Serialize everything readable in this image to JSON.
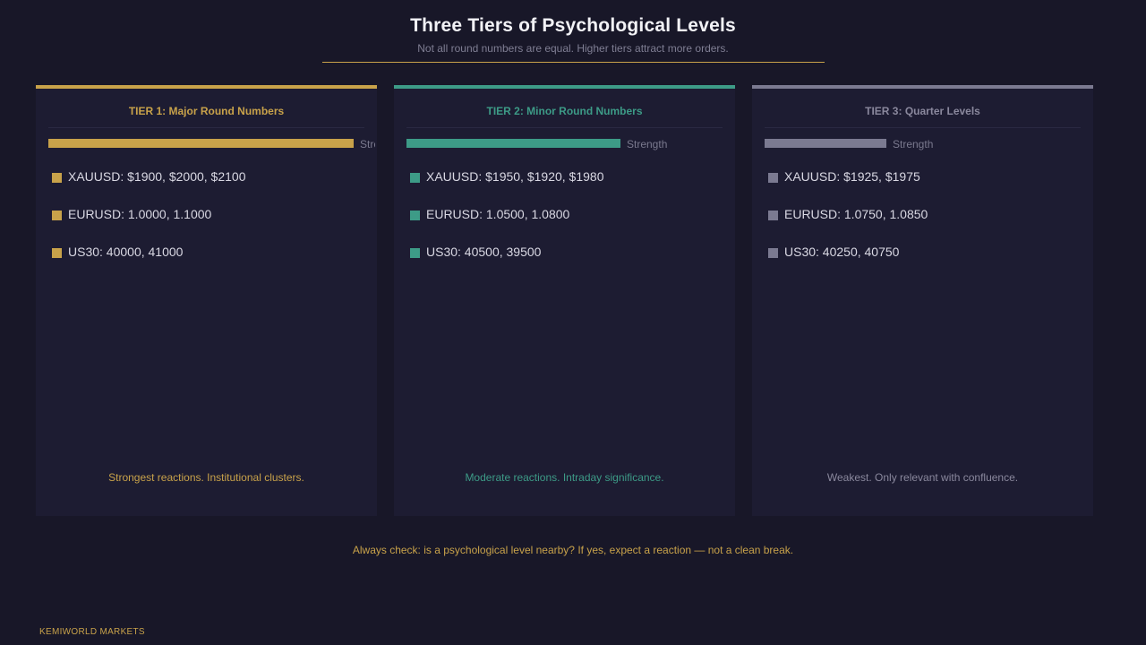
{
  "title": "Three Tiers of Psychological Levels",
  "subtitle": "Not all round numbers are equal. Higher tiers attract more orders.",
  "tiers": [
    {
      "name": "TIER 1: Major Round Numbers",
      "strength_label": "Strength",
      "strength": 1.0,
      "color": "#c8a24a",
      "levels": [
        "XAUUSD: $1900, $2000, $2100",
        "EURUSD: 1.0000, 1.1000",
        "US30: 40000, 41000"
      ],
      "footer": "Strongest reactions. Institutional clusters."
    },
    {
      "name": "TIER 2: Minor Round Numbers",
      "strength_label": "Strength",
      "strength": 0.7,
      "color": "#3d9b87",
      "levels": [
        "XAUUSD: $1950, $1920, $1980",
        "EURUSD: 1.0500, 1.0800",
        "US30: 40500, 39500"
      ],
      "footer": "Moderate reactions. Intraday significance."
    },
    {
      "name": "TIER 3: Quarter Levels",
      "strength_label": "Strength",
      "strength": 0.4,
      "color": "#7b7a91",
      "levels": [
        "XAUUSD: $1925, $1975",
        "EURUSD: 1.0750, 1.0850",
        "US30: 40250, 40750"
      ],
      "footer": "Weakest. Only relevant with confluence."
    }
  ],
  "note": "Always check: is a psychological level nearby? If yes, expect a reaction — not a clean break.",
  "brand": "KEMIWORLD MARKETS"
}
